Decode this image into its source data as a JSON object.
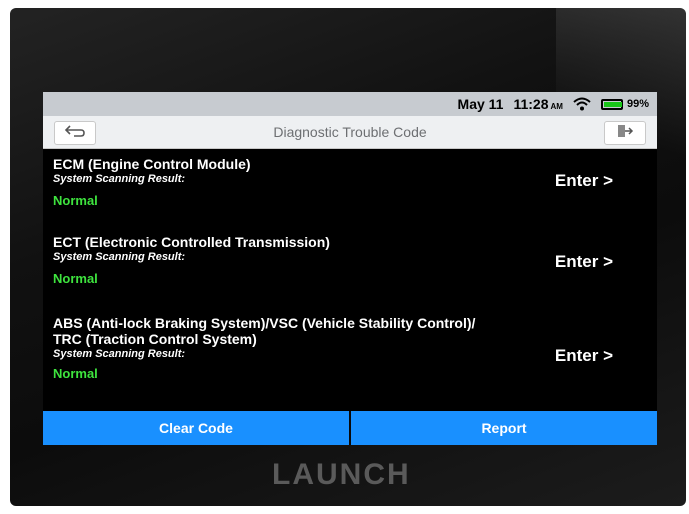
{
  "status_bar": {
    "date": "May 11",
    "time": "11:28",
    "ampm": "AM",
    "battery": "99%",
    "battery_level": 0.99,
    "icons": [
      "wifi-icon",
      "battery-icon"
    ]
  },
  "header": {
    "title": "Diagnostic Trouble Code",
    "back_icon": "back-arrow-icon",
    "exit_icon": "exit-icon"
  },
  "systems": [
    {
      "name": "ECM (Engine Control Module)",
      "result_label": "System Scanning Result:",
      "status": "Normal",
      "enter_label": "Enter >"
    },
    {
      "name": "ECT (Electronic Controlled Transmission)",
      "result_label": "System Scanning Result:",
      "status": "Normal",
      "enter_label": "Enter >"
    },
    {
      "name": "ABS (Anti-lock Braking System)/VSC (Vehicle Stability Control)/ TRC (Traction Control System)",
      "result_label": "System Scanning Result:",
      "status": "Normal",
      "enter_label": "Enter >"
    }
  ],
  "actions": {
    "clear_code": "Clear Code",
    "report": "Report"
  },
  "device": {
    "brand": "LAUNCH"
  },
  "colors": {
    "accent": "#1990ff",
    "status_normal": "#3ee33e",
    "screen_bg": "#000000"
  }
}
